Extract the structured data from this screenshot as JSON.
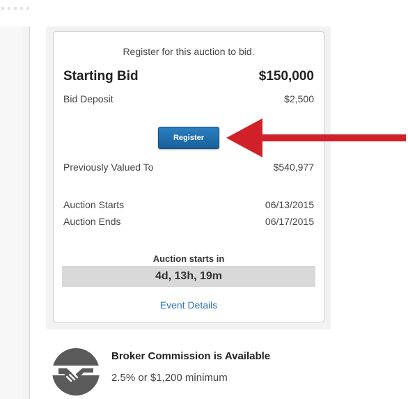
{
  "auction_card": {
    "prompt": "Register for this auction to bid.",
    "starting_bid_label": "Starting Bid",
    "starting_bid_value": "$150,000",
    "bid_deposit_label": "Bid Deposit",
    "bid_deposit_value": "$2,500",
    "register_button": "Register",
    "previously_valued_label": "Previously Valued To",
    "previously_valued_value": "$540,977",
    "auction_starts_label": "Auction Starts",
    "auction_starts_value": "06/13/2015",
    "auction_ends_label": "Auction Ends",
    "auction_ends_value": "06/17/2015",
    "countdown_label": "Auction starts in",
    "countdown_value": "4d, 13h, 19m",
    "event_details_link": "Event Details"
  },
  "broker": {
    "title": "Broker Commission is Available",
    "subtitle": "2.5% or $1,200 minimum",
    "icon": "handshake-icon"
  },
  "colors": {
    "accent_blue": "#1f6aa8",
    "link_blue": "#2a73b4",
    "arrow_red": "#d0202a",
    "countdown_bg": "#d9d9d9",
    "icon_gray": "#5a5a5a"
  }
}
